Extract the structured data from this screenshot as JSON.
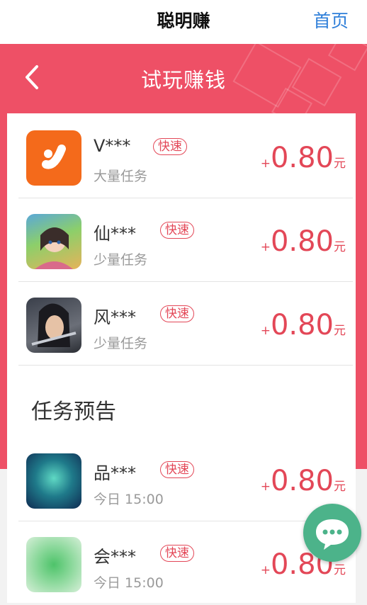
{
  "header": {
    "title": "聪明赚",
    "home_label": "首页"
  },
  "banner": {
    "title": "试玩赚钱",
    "background": "#ee5066"
  },
  "accent": "#e34757",
  "tasks": [
    {
      "name": "V***",
      "tag": "快速",
      "subtitle": "大量任务",
      "reward_prefix": "+",
      "amount": "0.80",
      "unit": "元",
      "icon": "orange-app-logo-icon"
    },
    {
      "name": "仙***",
      "tag": "快速",
      "subtitle": "少量任务",
      "reward_prefix": "+",
      "amount": "0.80",
      "unit": "元",
      "icon": "fantasy-girl-game-icon"
    },
    {
      "name": "风***",
      "tag": "快速",
      "subtitle": "少量任务",
      "reward_prefix": "+",
      "amount": "0.80",
      "unit": "元",
      "icon": "swordsman-game-icon"
    }
  ],
  "preview": {
    "heading": "任务预告",
    "items": [
      {
        "name": "品***",
        "tag": "快速",
        "subtitle": "今日 15:00",
        "reward_prefix": "+",
        "amount": "0.80",
        "unit": "元",
        "icon": "teal-blurred-app-icon"
      },
      {
        "name": "会***",
        "tag": "快速",
        "subtitle": "今日 15:00",
        "reward_prefix": "+",
        "amount": "0.80",
        "unit": "元",
        "icon": "green-blurred-app-icon"
      }
    ]
  },
  "chat_button": {
    "icon": "chat-bubble-icon",
    "color": "#4cb38a"
  }
}
